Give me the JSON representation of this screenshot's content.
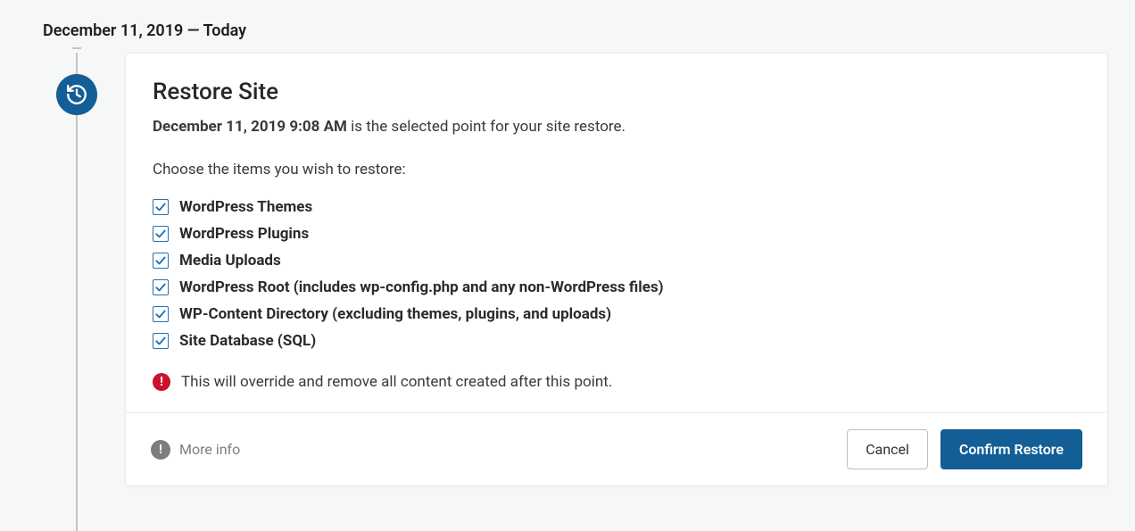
{
  "header": {
    "date_label": "December 11, 2019 — Today"
  },
  "card": {
    "title": "Restore Site",
    "selected_point_datetime": "December 11, 2019 9:08 AM",
    "selected_point_suffix": " is the selected point for your site restore.",
    "choose_label": "Choose the items you wish to restore:",
    "items": [
      {
        "label": "WordPress Themes",
        "checked": true
      },
      {
        "label": "WordPress Plugins",
        "checked": true
      },
      {
        "label": "Media Uploads",
        "checked": true
      },
      {
        "label": "WordPress Root (includes wp-config.php and any non-WordPress files)",
        "checked": true
      },
      {
        "label": "WP-Content Directory (excluding themes, plugins, and uploads)",
        "checked": true
      },
      {
        "label": "Site Database (SQL)",
        "checked": true
      }
    ],
    "warning_text": "This will override and remove all content created after this point."
  },
  "footer": {
    "more_info_label": "More info",
    "cancel_label": "Cancel",
    "confirm_label": "Confirm Restore"
  },
  "colors": {
    "accent": "#135e96",
    "danger": "#c9132c"
  }
}
